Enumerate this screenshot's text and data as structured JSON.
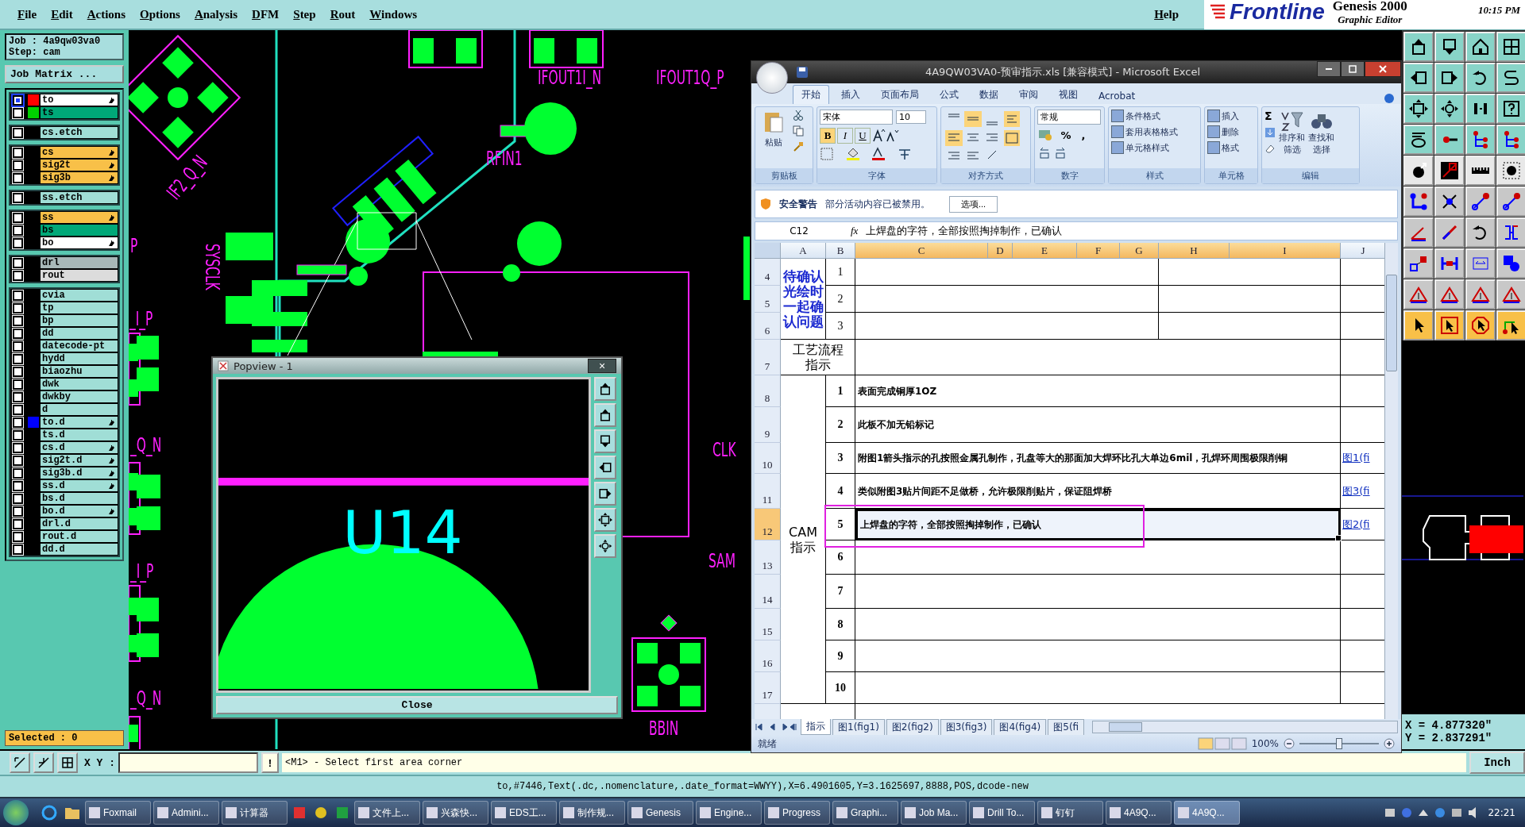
{
  "menu_bar": {
    "items": [
      "File",
      "Edit",
      "Actions",
      "Options",
      "Analysis",
      "DFM",
      "Step",
      "Rout",
      "Windows"
    ],
    "help": "Help"
  },
  "brand": {
    "logo": "Frontline",
    "product": "Genesis 2000",
    "subtitle": "Graphic Editor",
    "time": "10:15 PM"
  },
  "job_panel": {
    "job": "Job : 4a9qw03va0",
    "step": "Step: cam",
    "matrix_button": "Job Matrix ...",
    "selected_count": "Selected : 0"
  },
  "layer_groups": [
    {
      "layers": [
        {
          "name": "to",
          "kind": "silk",
          "color": "#ff0000",
          "linked": true,
          "selected": true
        },
        {
          "name": "ts",
          "kind": "mask",
          "color": "#00d000",
          "linked": false,
          "selected": false
        }
      ]
    },
    {
      "layers": [
        {
          "name": "cs.etch",
          "kind": "doc",
          "linked": false,
          "selected": false
        }
      ]
    },
    {
      "layers": [
        {
          "name": "cs",
          "kind": "signal",
          "linked": true,
          "selected": false
        },
        {
          "name": "sig2t",
          "kind": "signal",
          "linked": true,
          "selected": false
        },
        {
          "name": "sig3b",
          "kind": "signal",
          "linked": true,
          "selected": false
        }
      ]
    },
    {
      "layers": [
        {
          "name": "ss.etch",
          "kind": "doc",
          "linked": false,
          "selected": false
        }
      ]
    },
    {
      "layers": [
        {
          "name": "ss",
          "kind": "signal",
          "linked": true,
          "selected": false
        },
        {
          "name": "bs",
          "kind": "mask",
          "linked": false,
          "selected": false
        },
        {
          "name": "bo",
          "kind": "silk",
          "linked": true,
          "selected": false
        }
      ]
    },
    {
      "layers": [
        {
          "name": "drl",
          "kind": "drill",
          "linked": false,
          "selected": false
        },
        {
          "name": "rout",
          "kind": "rout",
          "linked": false,
          "selected": false
        }
      ]
    },
    {
      "layers": [
        {
          "name": "cvia",
          "kind": "doc",
          "linked": false,
          "selected": false
        },
        {
          "name": "tp",
          "kind": "doc",
          "linked": false,
          "selected": false
        },
        {
          "name": "bp",
          "kind": "doc",
          "linked": false,
          "selected": false
        },
        {
          "name": "dd",
          "kind": "doc",
          "linked": false,
          "selected": false
        },
        {
          "name": "datecode-pt",
          "kind": "doc",
          "linked": false,
          "selected": false
        },
        {
          "name": "hydd",
          "kind": "doc",
          "linked": false,
          "selected": false
        },
        {
          "name": "biaozhu",
          "kind": "doc",
          "linked": false,
          "selected": false
        },
        {
          "name": "dwk",
          "kind": "doc",
          "linked": false,
          "selected": false
        },
        {
          "name": "dwkby",
          "kind": "doc",
          "linked": false,
          "selected": false
        },
        {
          "name": "d",
          "kind": "doc",
          "linked": false,
          "selected": false
        },
        {
          "name": "to.d",
          "kind": "doc",
          "color": "#0000ff",
          "linked": true,
          "selected": false
        },
        {
          "name": "ts.d",
          "kind": "doc",
          "linked": false,
          "selected": false
        },
        {
          "name": "cs.d",
          "kind": "doc",
          "linked": true,
          "selected": false
        },
        {
          "name": "sig2t.d",
          "kind": "doc",
          "linked": true,
          "selected": false
        },
        {
          "name": "sig3b.d",
          "kind": "doc",
          "linked": true,
          "selected": false
        },
        {
          "name": "ss.d",
          "kind": "doc",
          "linked": true,
          "selected": false
        },
        {
          "name": "bs.d",
          "kind": "doc",
          "linked": false,
          "selected": false
        },
        {
          "name": "bo.d",
          "kind": "doc",
          "linked": true,
          "selected": false
        },
        {
          "name": "drl.d",
          "kind": "doc",
          "linked": false,
          "selected": false
        },
        {
          "name": "rout.d",
          "kind": "doc",
          "linked": false,
          "selected": false
        },
        {
          "name": "dd.d",
          "kind": "doc",
          "linked": false,
          "selected": false
        }
      ]
    }
  ],
  "canvas": {
    "labels": [
      "IFOUT1I_N",
      "IFOUT1Q_P",
      "RFIN1",
      "IF2_Q_N",
      "P",
      "SYSCLK",
      "_I_P",
      "_Q_N",
      "CLK",
      "SAM",
      "_I_P",
      "_Q_N",
      "BBIN"
    ]
  },
  "popview": {
    "title": "Popview - 1",
    "close_glyph": "×",
    "label": "U14",
    "close_button": "Close"
  },
  "excel": {
    "title": "4A9QW03VA0-预审指示.xls  [兼容模式] - Microsoft Excel",
    "tabs": [
      {
        "label": "开始",
        "selected": true
      },
      {
        "label": "插入",
        "selected": false
      },
      {
        "label": "页面布局",
        "selected": false
      },
      {
        "label": "公式",
        "selected": false
      },
      {
        "label": "数据",
        "selected": false
      },
      {
        "label": "审阅",
        "selected": false
      },
      {
        "label": "视图",
        "selected": false
      },
      {
        "label": "Acrobat",
        "selected": false
      }
    ],
    "ribbon": {
      "groups": [
        "剪贴板",
        "字体",
        "对齐方式",
        "数字",
        "样式",
        "单元格",
        "编辑"
      ],
      "paste": "粘贴",
      "font": "宋体",
      "size": "10",
      "format_buttons": [
        "B",
        "I",
        "U"
      ],
      "number_format": "常规",
      "number_buttons": [
        "%",
        ","
      ],
      "styles": [
        "条件格式",
        "套用表格格式",
        "单元格样式"
      ],
      "cells": [
        "插入",
        "删除",
        "格式"
      ],
      "sum": "Σ",
      "sort": [
        "排序和",
        "筛选"
      ],
      "find": [
        "查找和",
        "选择"
      ]
    },
    "security": {
      "title": "安全警告",
      "message": "部分活动内容已被禁用。",
      "button": "选项..."
    },
    "formula_bar": {
      "cell": "C12",
      "fx": "fx",
      "value": "上焊盘的字符，全部按照掏掉制作，已确认"
    },
    "columns": [
      {
        "label": "A",
        "selected": false
      },
      {
        "label": "B",
        "selected": false
      },
      {
        "label": "C",
        "selected": true
      },
      {
        "label": "D",
        "selected": true
      },
      {
        "label": "E",
        "selected": true
      },
      {
        "label": "F",
        "selected": true
      },
      {
        "label": "G",
        "selected": true
      },
      {
        "label": "H",
        "selected": true
      },
      {
        "label": "I",
        "selected": true
      },
      {
        "label": "J",
        "selected": false
      }
    ],
    "rows": [
      {
        "label": "4",
        "selected": false
      },
      {
        "label": "5",
        "selected": false
      },
      {
        "label": "6",
        "selected": false
      },
      {
        "label": "7",
        "selected": false
      },
      {
        "label": "8",
        "selected": false
      },
      {
        "label": "9",
        "selected": false
      },
      {
        "label": "10",
        "selected": false
      },
      {
        "label": "11",
        "selected": false
      },
      {
        "label": "12",
        "selected": true
      },
      {
        "label": "13",
        "selected": false
      },
      {
        "label": "14",
        "selected": false
      },
      {
        "label": "15",
        "selected": false
      },
      {
        "label": "16",
        "selected": false
      },
      {
        "label": "17",
        "selected": false
      }
    ],
    "sections": [
      {
        "kind": "question",
        "lines": [
          "待确认",
          "光绘时",
          "一起确",
          "认问题"
        ],
        "items": [
          {
            "number": "1",
            "selected": false
          },
          {
            "number": "2",
            "selected": false
          },
          {
            "number": "3",
            "selected": false
          }
        ]
      },
      {
        "kind": "process",
        "lines": [
          "工艺流程",
          "指示"
        ]
      },
      {
        "kind": "cam",
        "lines": [
          "CAM",
          "指示"
        ],
        "items": [
          {
            "number": "1",
            "text": "表面完成铜厚1OZ",
            "selected": false
          },
          {
            "number": "2",
            "text": "此板不加无铅标记",
            "selected": false
          },
          {
            "number": "3",
            "text": "附图1箭头指示的孔按照金属孔制作，孔盘等大的那面加大焊环比孔大单边6mil，孔焊环周围极限削铜",
            "link": "图1(fi",
            "selected": false
          },
          {
            "number": "4",
            "text": "类似附图3贴片间距不足做桥，允许极限削贴片，保证阻焊桥",
            "link": "图3(fi",
            "selected": false
          },
          {
            "number": "5",
            "text": "上焊盘的字符，全部按照掏掉制作，已确认",
            "link": "图2(fi",
            "selected": true
          },
          {
            "number": "6",
            "selected": false
          },
          {
            "number": "7",
            "selected": false
          },
          {
            "number": "8",
            "selected": false
          },
          {
            "number": "9",
            "selected": false
          },
          {
            "number": "10",
            "selected": false
          }
        ]
      }
    ],
    "sheet_tabs": [
      {
        "label": "指示",
        "selected": true
      },
      {
        "label": "图1(fig1)",
        "selected": false
      },
      {
        "label": "图2(fig2)",
        "selected": false
      },
      {
        "label": "图3(fig3)",
        "selected": false
      },
      {
        "label": "图4(fig4)",
        "selected": false
      },
      {
        "label": "图5(fi",
        "selected": false
      }
    ],
    "status": "就绪",
    "zoom": {
      "reading": "100%",
      "level": 0.5
    }
  },
  "coordinates": {
    "x": "X = 4.877320\"",
    "y": "Y = 2.837291\""
  },
  "command_bar": {
    "label": "X Y :",
    "execute": "!",
    "prompt": "<M1> - Select first area corner",
    "units": "Inch"
  },
  "status_line": "to,#7446,Text(.dc,.nomenclature,.date_format=WWYY),X=6.4901605,Y=3.1625697,8888,POS,dcode-new",
  "taskbar": {
    "items": [
      {
        "label": "Foxmail",
        "selected": false
      },
      {
        "label": "Admini...",
        "selected": false
      },
      {
        "label": "计算器",
        "selected": false
      },
      {
        "label": "文件上...",
        "selected": false
      },
      {
        "label": "兴森快...",
        "selected": false
      },
      {
        "label": "EDS工...",
        "selected": false
      },
      {
        "label": "制作规...",
        "selected": false
      },
      {
        "label": "Genesis",
        "selected": false
      },
      {
        "label": "Engine...",
        "selected": false
      },
      {
        "label": "Progress",
        "selected": false
      },
      {
        "label": "Graphi...",
        "selected": false
      },
      {
        "label": "Job Ma...",
        "selected": false
      },
      {
        "label": "Drill To...",
        "selected": false
      },
      {
        "label": "钉钉",
        "selected": false
      },
      {
        "label": "4A9Q...",
        "selected": false
      },
      {
        "label": "4A9Q...",
        "selected": true
      }
    ],
    "clock": "22:21"
  }
}
